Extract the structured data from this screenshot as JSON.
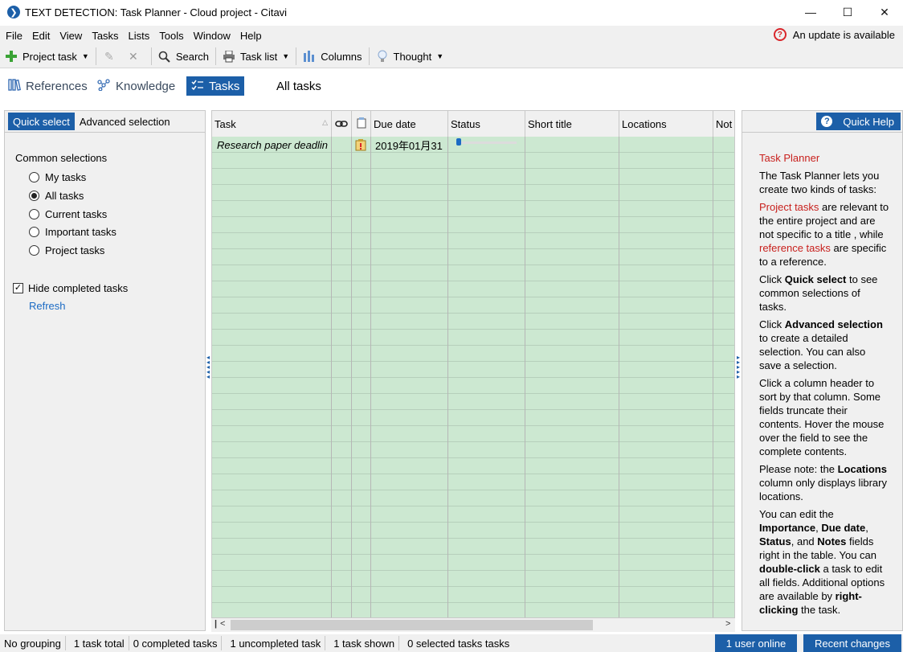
{
  "window": {
    "title": "TEXT DETECTION: Task Planner - Cloud project - Citavi",
    "minimize": "—",
    "maximize": "☐",
    "close": "✕"
  },
  "menu": {
    "items": [
      "File",
      "Edit",
      "View",
      "Tasks",
      "Lists",
      "Tools",
      "Window",
      "Help"
    ],
    "update_notice": "An update is available"
  },
  "toolbar": {
    "project_task": "Project task",
    "search": "Search",
    "task_list": "Task list",
    "columns": "Columns",
    "thought": "Thought"
  },
  "nav": {
    "references": "References",
    "knowledge": "Knowledge",
    "tasks": "Tasks",
    "all_tasks": "All tasks"
  },
  "left_panel": {
    "tab_quick_select": "Quick select",
    "tab_advanced": "Advanced selection",
    "common_selections": "Common selections",
    "options": [
      "My tasks",
      "All tasks",
      "Current tasks",
      "Important tasks",
      "Project tasks"
    ],
    "selected_option": "All tasks",
    "hide_completed": "Hide completed tasks",
    "hide_completed_checked": true,
    "refresh": "Refresh"
  },
  "grid": {
    "columns": [
      "Task",
      "",
      "",
      "Due date",
      "Status",
      "Short title",
      "Locations",
      "Not"
    ],
    "rows": [
      {
        "task": "Research paper deadlin",
        "due_date": "2019年01月31",
        "status_progress": 0.02
      }
    ]
  },
  "quick_help": {
    "button": "Quick Help",
    "title": "Task Planner",
    "p1": "The Task Planner lets you create two kinds of tasks:",
    "p2_red1": "Project tasks",
    "p2_a": " are relevant to the entire project and are not specific to a title , while ",
    "p2_red2": "reference tasks",
    "p2_b": " are specific to a reference.",
    "p3_a": "Click ",
    "p3_bold": "Quick select",
    "p3_b": " to see common selections of tasks.",
    "p4_a": "Click ",
    "p4_bold": "Advanced selection",
    "p4_b": " to create a detailed selection. You can also save a selection.",
    "p5": "Click a column header to sort by that column. Some fields truncate their contents. Hover the mouse over the field to see the complete contents.",
    "p6_a": "Please note: the ",
    "p6_bold": "Locations",
    "p6_b": " column only displays library locations.",
    "p7_a": "You can edit the ",
    "p7_b1": "Importance",
    "p7_c": ", ",
    "p7_b2": "Due date",
    "p7_d": ", ",
    "p7_b3": "Status",
    "p7_e": ", and ",
    "p7_b4": "Notes",
    "p7_f": " fields right in the table. You can ",
    "p7_b5": "double-click",
    "p7_g": " a task to edit all fields. Additional options are available by ",
    "p7_b6": "right-clicking",
    "p7_h": " the task."
  },
  "status_bar": {
    "grouping": "No grouping",
    "total": "1 task total",
    "completed": "0 completed tasks",
    "uncompleted": "1 uncompleted task",
    "shown": "1 task shown",
    "selected": "0 selected tasks tasks",
    "users_online": "1 user online",
    "recent_changes": "Recent changes"
  },
  "colors": {
    "accent": "#1c5fa8",
    "grid_background": "#cce8d1",
    "help_highlight": "#c8201d"
  }
}
